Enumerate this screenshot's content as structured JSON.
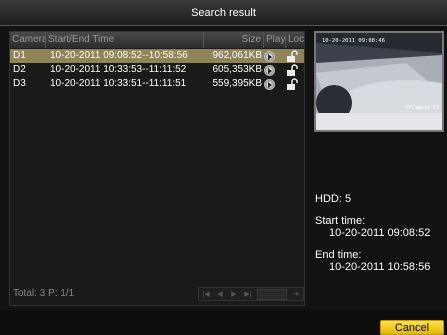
{
  "window": {
    "title": "Search result"
  },
  "table": {
    "headers": {
      "camera": "Camera",
      "time": "Start/End Time",
      "size": "Size",
      "play": "Play",
      "lock": "Lock"
    },
    "rows": [
      {
        "camera": "D1",
        "time": "10-20-2011 09:08:52--10:58:56",
        "size": "962,061KB",
        "selected": true
      },
      {
        "camera": "D2",
        "time": "10-20-2011 10:33:53--11:11:52",
        "size": "605,353KB",
        "selected": false
      },
      {
        "camera": "D3",
        "time": "10-20-2011 10:33:51--11:11:51",
        "size": "559,395KB",
        "selected": false
      }
    ],
    "footer": {
      "total": "Total: 3  P: 1/1"
    }
  },
  "preview": {
    "overlay_time": "10-20-2011 09:08:46",
    "camera_label": "IPCamera 03"
  },
  "info": {
    "hdd": "HDD: 5",
    "start_label": "Start time:",
    "start_value": "10-20-2011 09:08:52",
    "end_label": "End time:",
    "end_value": "10-20-2011 10:58:56"
  },
  "buttons": {
    "cancel": "Cancel"
  },
  "colors": {
    "selected_row": "#8f8358",
    "cancel_bg": "#ffd21e",
    "title_bg": "#2a2a2a"
  },
  "icons": [
    "play-icon",
    "lock-open-icon",
    "first-page-icon",
    "prev-page-icon",
    "next-page-icon",
    "last-page-icon",
    "go-icon"
  ]
}
